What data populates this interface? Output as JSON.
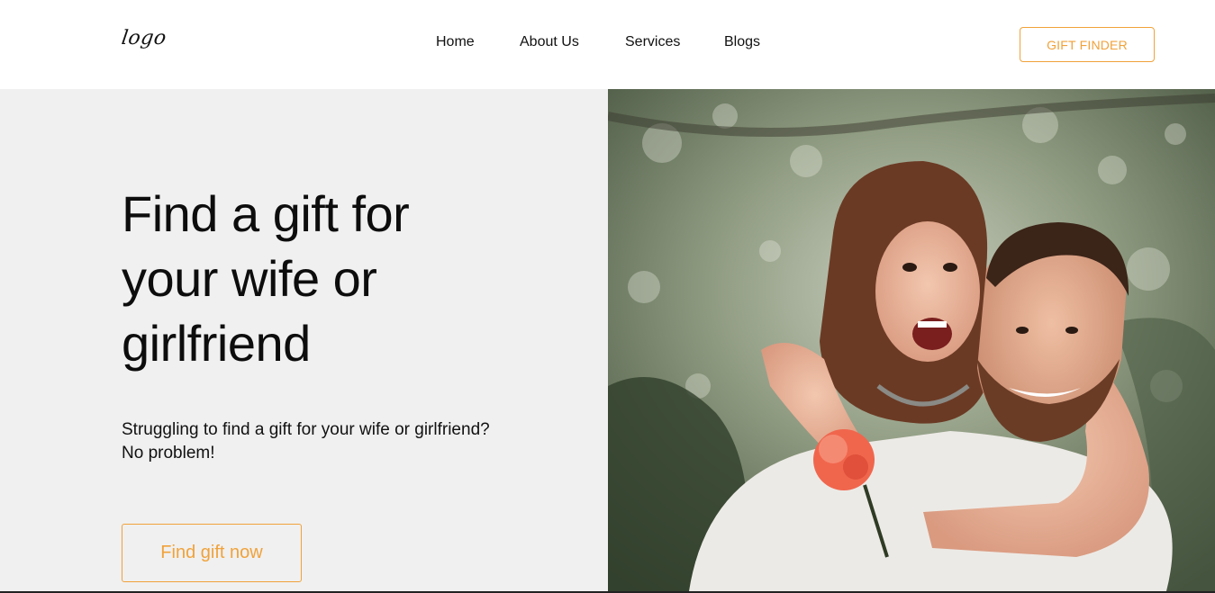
{
  "header": {
    "logo_text": "logo",
    "nav": [
      {
        "label": "Home"
      },
      {
        "label": "About Us"
      },
      {
        "label": "Services"
      },
      {
        "label": "Blogs"
      }
    ],
    "cta_label": "GIFT FINDER"
  },
  "hero": {
    "title": "Find a gift for your wife or girlfriend",
    "subtitle": "Struggling to find a gift for your wife or girlfriend? No problem!",
    "button_label": "Find gift now",
    "photo": "couple-piggyback-photo"
  },
  "colors": {
    "accent": "#f0a23a",
    "hero_bg": "#f0f0f0",
    "text": "#111111"
  }
}
